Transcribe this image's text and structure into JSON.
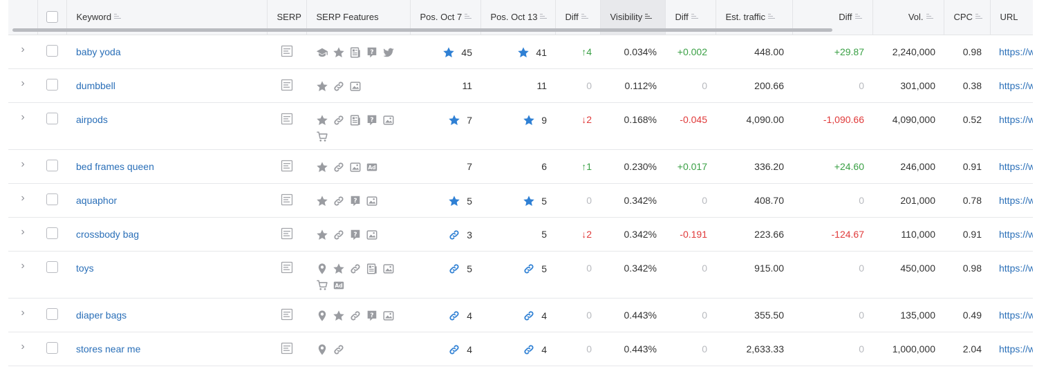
{
  "header": {
    "keyword": "Keyword",
    "serp": "SERP",
    "serp_features": "SERP Features",
    "pos_oct7": "Pos. Oct 7",
    "pos_oct13": "Pos. Oct 13",
    "diff": "Diff",
    "visibility": "Visibility",
    "diff2": "Diff",
    "est_traffic": "Est. traffic",
    "diff3": "Diff",
    "vol": "Vol.",
    "cpc": "CPC",
    "url": "URL"
  },
  "colors": {
    "link": "#2a6fb8",
    "up": "#3aa045",
    "down": "#e03a3a",
    "star": "#2f80d4",
    "feature_gray": "#9a9ca1"
  },
  "rows": [
    {
      "keyword": "baby yoda",
      "features": [
        "graduation-cap-icon",
        "star-icon",
        "news-icon",
        "question-icon",
        "twitter-icon"
      ],
      "pos7": "45",
      "pos7_icon": "star",
      "pos13": "41",
      "pos13_icon": "star",
      "diff": "4",
      "diff_dir": "up",
      "visibility": "0.034%",
      "vis_diff": "+0.002",
      "vis_diff_dir": "pos",
      "traffic": "448.00",
      "traffic_diff": "+29.87",
      "traffic_diff_dir": "pos",
      "vol": "2,240,000",
      "cpc": "0.98",
      "url": "https://w"
    },
    {
      "keyword": "dumbbell",
      "features": [
        "star-icon",
        "link-icon",
        "image-icon"
      ],
      "pos7": "11",
      "pos7_icon": "",
      "pos13": "11",
      "pos13_icon": "",
      "diff": "0",
      "diff_dir": "zero",
      "visibility": "0.112%",
      "vis_diff": "0",
      "vis_diff_dir": "zero",
      "traffic": "200.66",
      "traffic_diff": "0",
      "traffic_diff_dir": "zero",
      "vol": "301,000",
      "cpc": "0.38",
      "url": "https://w"
    },
    {
      "keyword": "airpods",
      "features": [
        "star-icon",
        "link-icon",
        "news-icon",
        "question-icon",
        "image-icon",
        "cart-icon"
      ],
      "pos7": "7",
      "pos7_icon": "star",
      "pos13": "9",
      "pos13_icon": "star",
      "diff": "2",
      "diff_dir": "down",
      "visibility": "0.168%",
      "vis_diff": "-0.045",
      "vis_diff_dir": "neg",
      "traffic": "4,090.00",
      "traffic_diff": "-1,090.66",
      "traffic_diff_dir": "neg",
      "vol": "4,090,000",
      "cpc": "0.52",
      "url": "https://w"
    },
    {
      "keyword": "bed frames queen",
      "features": [
        "star-icon",
        "link-icon",
        "image-icon",
        "ad-icon"
      ],
      "pos7": "7",
      "pos7_icon": "",
      "pos13": "6",
      "pos13_icon": "",
      "diff": "1",
      "diff_dir": "up",
      "visibility": "0.230%",
      "vis_diff": "+0.017",
      "vis_diff_dir": "pos",
      "traffic": "336.20",
      "traffic_diff": "+24.60",
      "traffic_diff_dir": "pos",
      "vol": "246,000",
      "cpc": "0.91",
      "url": "https://w"
    },
    {
      "keyword": "aquaphor",
      "features": [
        "star-icon",
        "link-icon",
        "question-icon",
        "image-icon"
      ],
      "pos7": "5",
      "pos7_icon": "star",
      "pos13": "5",
      "pos13_icon": "star",
      "diff": "0",
      "diff_dir": "zero",
      "visibility": "0.342%",
      "vis_diff": "0",
      "vis_diff_dir": "zero",
      "traffic": "408.70",
      "traffic_diff": "0",
      "traffic_diff_dir": "zero",
      "vol": "201,000",
      "cpc": "0.78",
      "url": "https://w"
    },
    {
      "keyword": "crossbody bag",
      "features": [
        "star-icon",
        "link-icon",
        "question-icon",
        "image-icon"
      ],
      "pos7": "3",
      "pos7_icon": "link",
      "pos13": "5",
      "pos13_icon": "",
      "diff": "2",
      "diff_dir": "down",
      "visibility": "0.342%",
      "vis_diff": "-0.191",
      "vis_diff_dir": "neg",
      "traffic": "223.66",
      "traffic_diff": "-124.67",
      "traffic_diff_dir": "neg",
      "vol": "110,000",
      "cpc": "0.91",
      "url": "https://w"
    },
    {
      "keyword": "toys",
      "features": [
        "pin-icon",
        "star-icon",
        "link-icon",
        "news-icon",
        "image-icon",
        "cart-icon",
        "ad-icon"
      ],
      "pos7": "5",
      "pos7_icon": "link",
      "pos13": "5",
      "pos13_icon": "link",
      "diff": "0",
      "diff_dir": "zero",
      "visibility": "0.342%",
      "vis_diff": "0",
      "vis_diff_dir": "zero",
      "traffic": "915.00",
      "traffic_diff": "0",
      "traffic_diff_dir": "zero",
      "vol": "450,000",
      "cpc": "0.98",
      "url": "https://w"
    },
    {
      "keyword": "diaper bags",
      "features": [
        "pin-icon",
        "star-icon",
        "link-icon",
        "question-icon",
        "image-icon"
      ],
      "pos7": "4",
      "pos7_icon": "link",
      "pos13": "4",
      "pos13_icon": "link",
      "diff": "0",
      "diff_dir": "zero",
      "visibility": "0.443%",
      "vis_diff": "0",
      "vis_diff_dir": "zero",
      "traffic": "355.50",
      "traffic_diff": "0",
      "traffic_diff_dir": "zero",
      "vol": "135,000",
      "cpc": "0.49",
      "url": "https://w"
    },
    {
      "keyword": "stores near me",
      "features": [
        "pin-icon",
        "link-icon"
      ],
      "pos7": "4",
      "pos7_icon": "link",
      "pos13": "4",
      "pos13_icon": "link",
      "diff": "0",
      "diff_dir": "zero",
      "visibility": "0.443%",
      "vis_diff": "0",
      "vis_diff_dir": "zero",
      "traffic": "2,633.33",
      "traffic_diff": "0",
      "traffic_diff_dir": "zero",
      "vol": "1,000,000",
      "cpc": "2.04",
      "url": "https://w"
    }
  ]
}
